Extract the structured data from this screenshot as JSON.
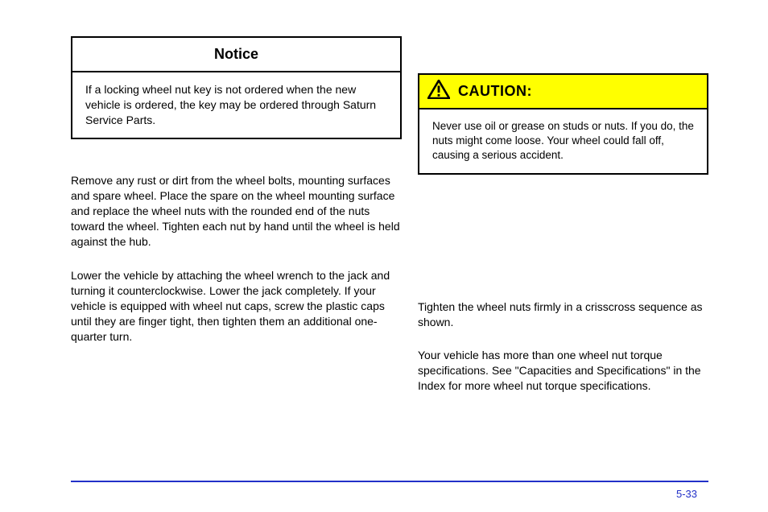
{
  "notice": {
    "heading": "Notice",
    "body": "If a locking wheel nut key is not ordered when the new vehicle is ordered, the key may be ordered through Saturn Service Parts."
  },
  "caution": {
    "label": "CAUTION:",
    "body_prefix": "Never use oil or grease on studs or nuts. If you do, the nuts might come loose. Your wheel could fall off, causing a serious accident."
  },
  "left_paragraphs": {
    "p1": "Remove any rust or dirt from the wheel bolts, mounting surfaces and spare wheel. Place the spare on the wheel mounting surface and replace the wheel nuts with the rounded end of the nuts toward the wheel. Tighten each nut by hand until the wheel is held against the hub.",
    "p2": "Lower the vehicle by attaching the wheel wrench to the jack and turning it counterclockwise. Lower the jack completely. If your vehicle is equipped with wheel nut caps, screw the plastic caps until they are finger tight, then tighten them an additional one-quarter turn.",
    "p3": ""
  },
  "right_paragraphs": {
    "rp1": "Tighten the wheel nuts firmly in a crisscross sequence as shown.",
    "rp2": "Your vehicle has more than one wheel nut torque specifications. See \"Capacities and Specifications\" in the Index for more wheel nut torque specifications."
  },
  "page_number": "5-33"
}
